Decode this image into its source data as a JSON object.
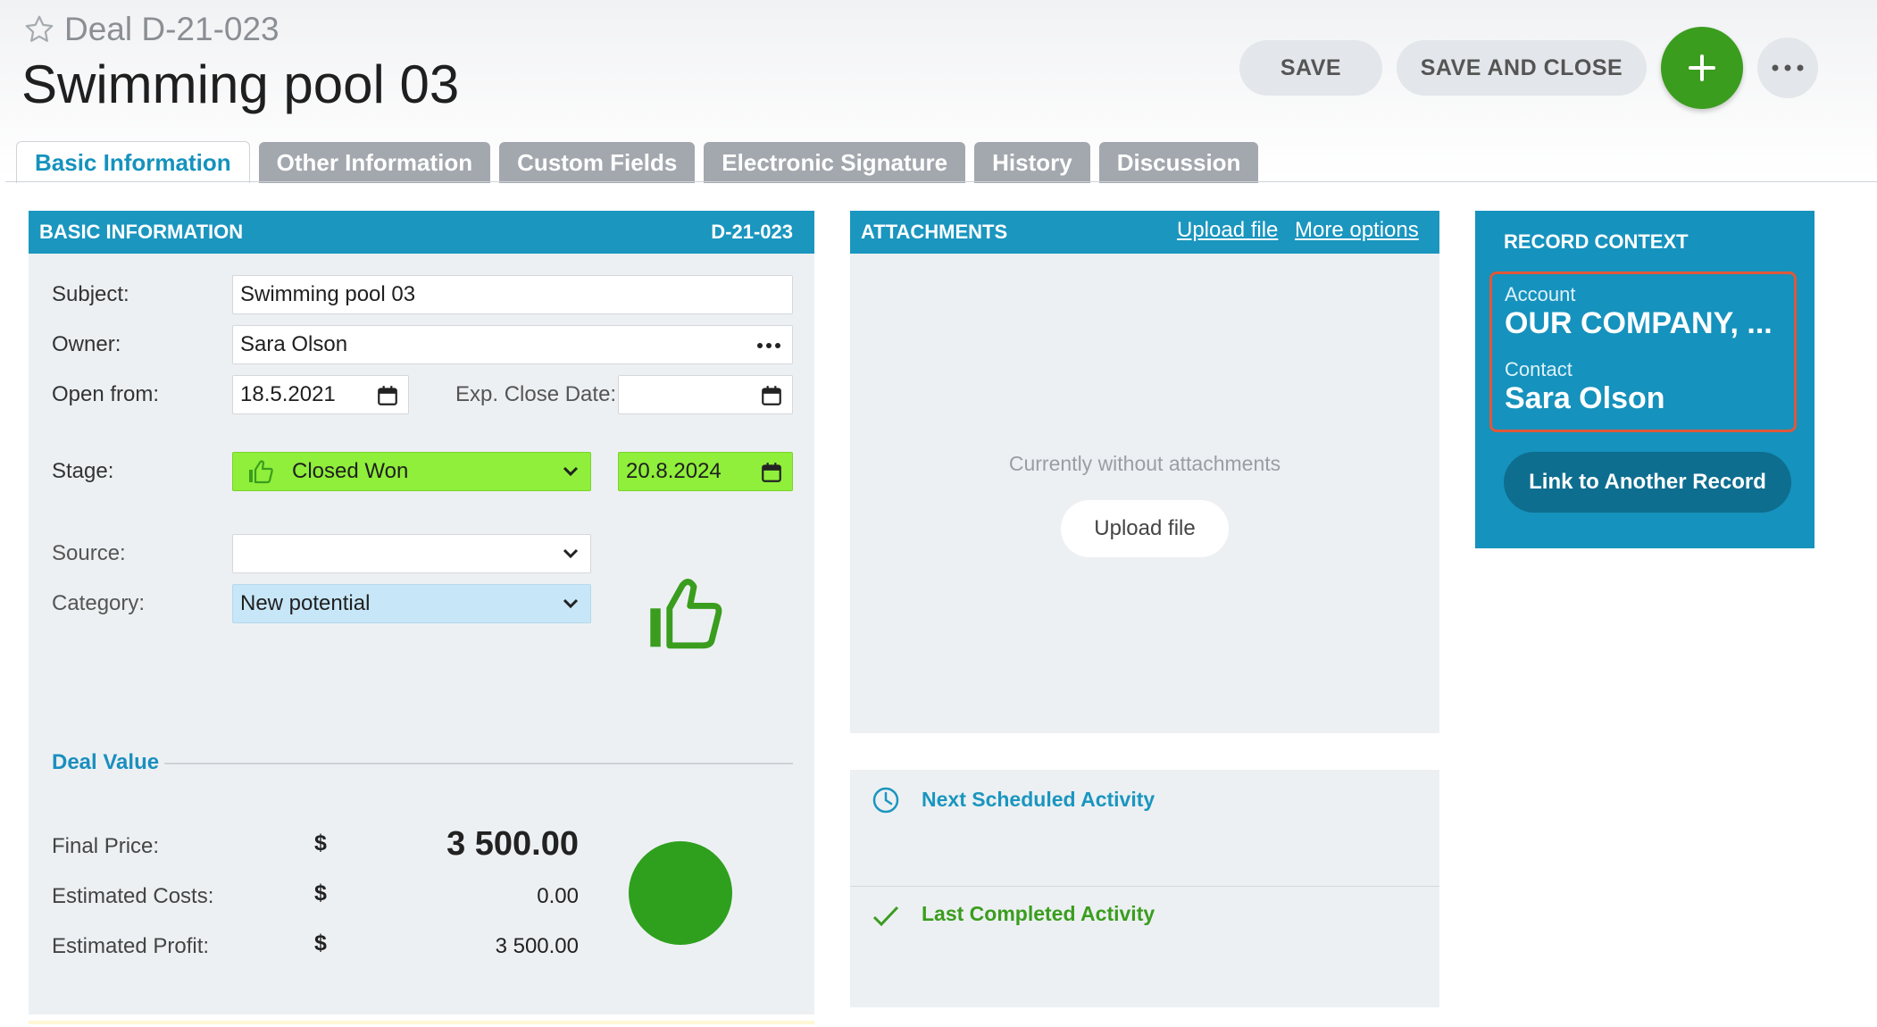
{
  "header": {
    "deal_label": "Deal D-21-023",
    "title": "Swimming pool 03",
    "save_label": "SAVE",
    "save_close_label": "SAVE AND CLOSE",
    "add_icon": "plus-icon",
    "more_icon": "ellipsis-icon"
  },
  "tabs": [
    {
      "label": "Basic Information",
      "active": true
    },
    {
      "label": "Other Information"
    },
    {
      "label": "Custom Fields"
    },
    {
      "label": "Electronic Signature"
    },
    {
      "label": "History"
    },
    {
      "label": "Discussion"
    }
  ],
  "basic": {
    "header": "BASIC INFORMATION",
    "record_id": "D-21-023",
    "subject_label": "Subject:",
    "subject_value": "Swimming pool 03",
    "owner_label": "Owner:",
    "owner_value": "Sara Olson",
    "open_from_label": "Open from:",
    "open_from_value": "18.5.2021",
    "exp_close_label": "Exp. Close Date:",
    "exp_close_value": "",
    "stage_label": "Stage:",
    "stage_value": "Closed Won",
    "stage_date": "20.8.2024",
    "source_label": "Source:",
    "source_value": "",
    "category_label": "Category:",
    "category_value": "New potential",
    "deal_value_title": "Deal Value",
    "final_price_label": "Final Price:",
    "final_price_value": "3 500.00",
    "est_costs_label": "Estimated Costs:",
    "est_costs_value": "0.00",
    "est_profit_label": "Estimated Profit:",
    "est_profit_value": "3 500.00",
    "currency": "$"
  },
  "attachments": {
    "header": "ATTACHMENTS",
    "upload_link": "Upload file",
    "more_options_link": "More options",
    "empty_text": "Currently without attachments",
    "upload_button": "Upload file"
  },
  "activities": {
    "next_label": "Next Scheduled Activity",
    "last_label": "Last Completed Activity"
  },
  "context": {
    "title": "RECORD CONTEXT",
    "account_label": "Account",
    "account_value": "OUR COMPANY, ...",
    "contact_label": "Contact",
    "contact_value": "Sara Olson",
    "link_button": "Link to Another Record"
  },
  "colors": {
    "accent": "#1a96bf",
    "green": "#3a9d1e",
    "stage_bg": "#8fef3a",
    "category_bg": "#c7e6f7",
    "highlight": "#e0583a"
  }
}
